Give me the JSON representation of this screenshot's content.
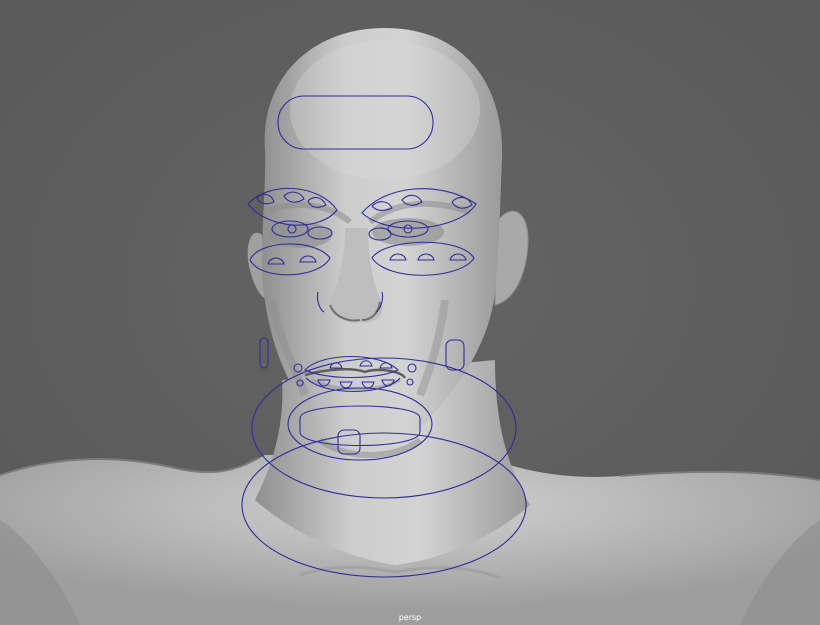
{
  "viewport": {
    "camera_label": "persp",
    "background_color": "#5e5e5e",
    "mesh_color": "#c8c8c8",
    "controller_color": "#2e2e9a"
  },
  "scene": {
    "model": "male-head-and-shoulders",
    "controls": [
      "forehead-control",
      "brow-control-left",
      "brow-control-right",
      "eye-control-left",
      "eye-control-right",
      "cheek-control-left",
      "cheek-control-right",
      "nostril-control",
      "mouth-corner-control-left",
      "mouth-corner-control-right",
      "upper-lip-control",
      "lower-lip-control",
      "chin-control",
      "jaw-control",
      "neck-control-outer",
      "neck-control-inner"
    ]
  }
}
